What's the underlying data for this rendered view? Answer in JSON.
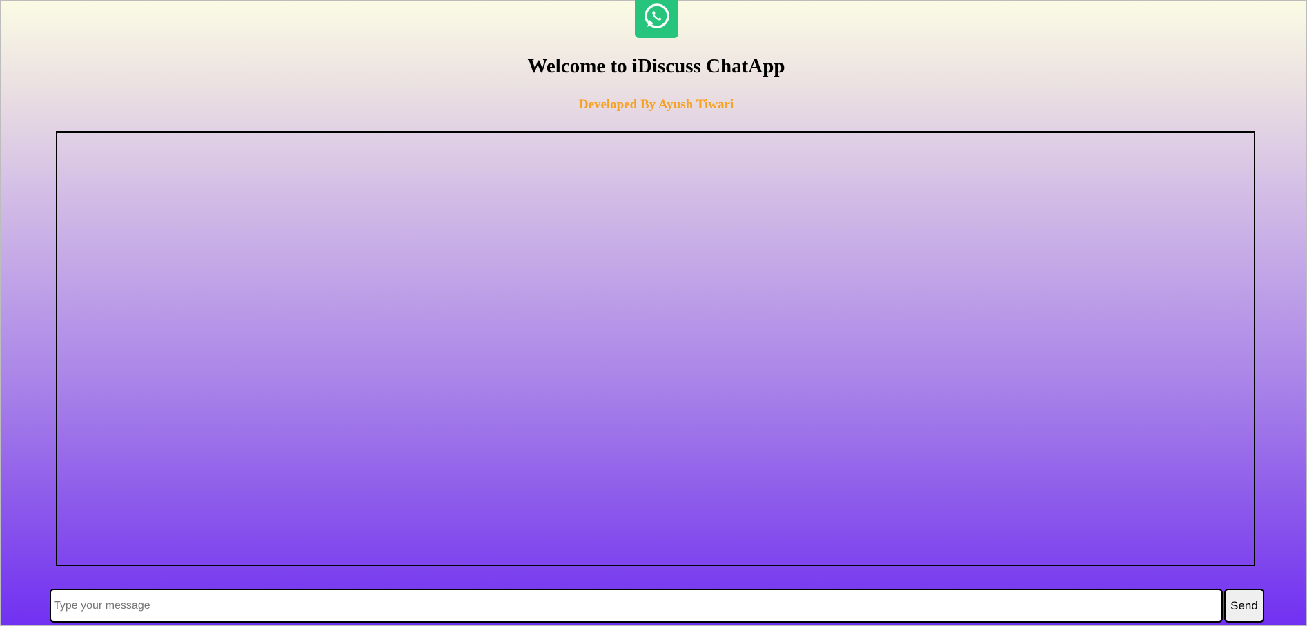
{
  "header": {
    "logo_icon": "whatsapp-icon",
    "logo_color": "#27c47d",
    "title": "Welcome to iDiscuss ChatApp",
    "subtitle": "Developed By Ayush Tiwari",
    "subtitle_color": "#f5a020"
  },
  "chat": {
    "messages": []
  },
  "composer": {
    "input_value": "",
    "input_placeholder": "Type your message",
    "send_label": "Send"
  }
}
